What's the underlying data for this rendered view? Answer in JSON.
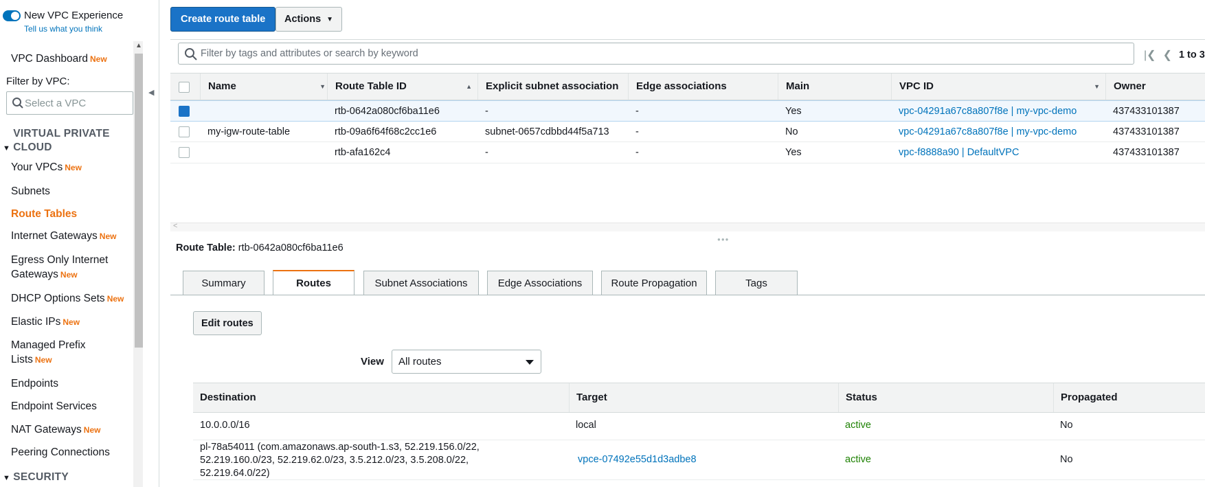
{
  "sidebar": {
    "toggle_label": "New VPC Experience",
    "feedback_link": "Tell us what you think",
    "filter_label": "Filter by VPC:",
    "vpc_select_placeholder": "Select a VPC",
    "new_badge": "New",
    "dashboard": "VPC Dashboard",
    "section_vpc": "VIRTUAL PRIVATE CLOUD",
    "section_security": "SECURITY",
    "items": [
      {
        "label": "Your VPCs",
        "new": true
      },
      {
        "label": "Subnets",
        "new": false
      },
      {
        "label": "Route Tables",
        "new": false,
        "active": true
      },
      {
        "label": "Internet Gateways",
        "new": true
      },
      {
        "label": "Egress Only Internet",
        "label2": "Gateways",
        "new": true
      },
      {
        "label": "DHCP Options Sets",
        "new": true
      },
      {
        "label": "Elastic IPs",
        "new": true
      },
      {
        "label": "Managed Prefix",
        "label2": "Lists",
        "new": true
      },
      {
        "label": "Endpoints",
        "new": false
      },
      {
        "label": "Endpoint Services",
        "new": false
      },
      {
        "label": "NAT Gateways",
        "new": true
      },
      {
        "label": "Peering Connections",
        "new": false
      }
    ]
  },
  "toolbar": {
    "create_label": "Create route table",
    "actions_label": "Actions"
  },
  "search": {
    "placeholder": "Filter by tags and attributes or search by keyword"
  },
  "pagination": {
    "text": "1 to 3"
  },
  "route_tables": {
    "columns": [
      "Name",
      "Route Table ID",
      "Explicit subnet association",
      "Edge associations",
      "Main",
      "VPC ID",
      "Owner"
    ],
    "rows": [
      {
        "name": "",
        "id": "rtb-0642a080cf6ba11e6",
        "subnet": "-",
        "edge": "-",
        "main": "Yes",
        "vpc": "vpc-04291a67c8a807f8e | my-vpc-demo",
        "owner": "437433101387",
        "selected": true
      },
      {
        "name": "my-igw-route-table",
        "id": "rtb-09a6f64f68c2cc1e6",
        "subnet": "subnet-0657cdbbd44f5a713",
        "edge": "-",
        "main": "No",
        "vpc": "vpc-04291a67c8a807f8e | my-vpc-demo",
        "owner": "437433101387",
        "selected": false
      },
      {
        "name": "",
        "id": "rtb-afa162c4",
        "subnet": "-",
        "edge": "-",
        "main": "Yes",
        "vpc": "vpc-f8888a90 | DefaultVPC",
        "owner": "437433101387",
        "selected": false
      }
    ]
  },
  "detail": {
    "label": "Route Table:",
    "id": "rtb-0642a080cf6ba11e6",
    "tabs": [
      "Summary",
      "Routes",
      "Subnet Associations",
      "Edge Associations",
      "Route Propagation",
      "Tags"
    ],
    "active_tab": "Routes",
    "edit_routes_label": "Edit routes",
    "view_label": "View",
    "view_value": "All routes"
  },
  "routes": {
    "columns": [
      "Destination",
      "Target",
      "Status",
      "Propagated"
    ],
    "rows": [
      {
        "destination": "10.0.0.0/16",
        "target": "local",
        "status": "active",
        "propagated": "No"
      },
      {
        "destination_lines": [
          "pl-78a54011 (com.amazonaws.ap-south-1.s3, 52.219.156.0/22,",
          "52.219.160.0/23, 52.219.62.0/23, 3.5.212.0/23, 3.5.208.0/22,",
          "52.219.64.0/22)"
        ],
        "target": "vpce-07492e55d1d3adbe8",
        "status": "active",
        "propagated": "No"
      }
    ]
  },
  "colors": {
    "primary": "#1a73c7",
    "accent_orange": "#ec7211",
    "link": "#0073bb",
    "status_active": "#1d8102"
  }
}
